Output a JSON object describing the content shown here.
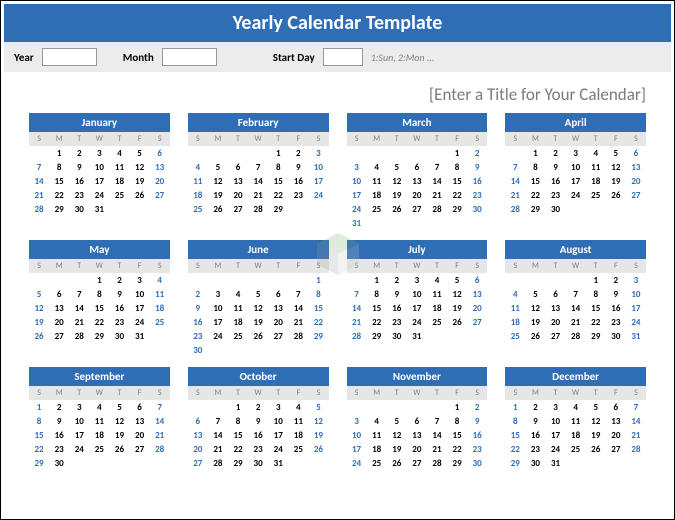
{
  "header_title": "Yearly Calendar Template",
  "controls": {
    "year_label": "Year",
    "year_value": "",
    "month_label": "Month",
    "month_value": "",
    "startday_label": "Start Day",
    "startday_value": "",
    "hint": "1:Sun, 2:Mon ..."
  },
  "title_placeholder": "[Enter a Title for Your Calendar]",
  "dow": [
    "S",
    "M",
    "T",
    "W",
    "T",
    "F",
    "S"
  ],
  "months": [
    {
      "name": "January",
      "start": 1,
      "days": 31
    },
    {
      "name": "February",
      "start": 4,
      "days": 29
    },
    {
      "name": "March",
      "start": 5,
      "days": 31
    },
    {
      "name": "April",
      "start": 1,
      "days": 30
    },
    {
      "name": "May",
      "start": 3,
      "days": 31
    },
    {
      "name": "June",
      "start": 6,
      "days": 30
    },
    {
      "name": "July",
      "start": 1,
      "days": 31
    },
    {
      "name": "August",
      "start": 4,
      "days": 31
    },
    {
      "name": "September",
      "start": 0,
      "days": 30
    },
    {
      "name": "October",
      "start": 2,
      "days": 31
    },
    {
      "name": "November",
      "start": 5,
      "days": 30
    },
    {
      "name": "December",
      "start": 0,
      "days": 31
    }
  ]
}
